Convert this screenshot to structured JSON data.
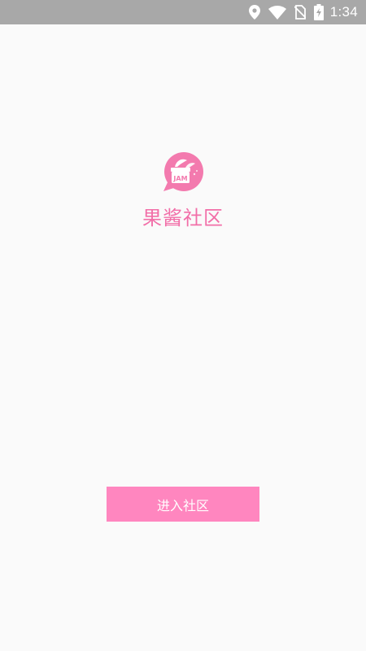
{
  "status_bar": {
    "time": "1:34",
    "icons": [
      "location-icon",
      "wifi-icon",
      "no-sim-icon",
      "battery-charging-icon"
    ]
  },
  "app": {
    "logo_text": "JAM",
    "name": "果酱社区",
    "accent_color": "#f26ea8"
  },
  "enter_button": {
    "label": "进入社区",
    "color": "#ff86bf"
  }
}
